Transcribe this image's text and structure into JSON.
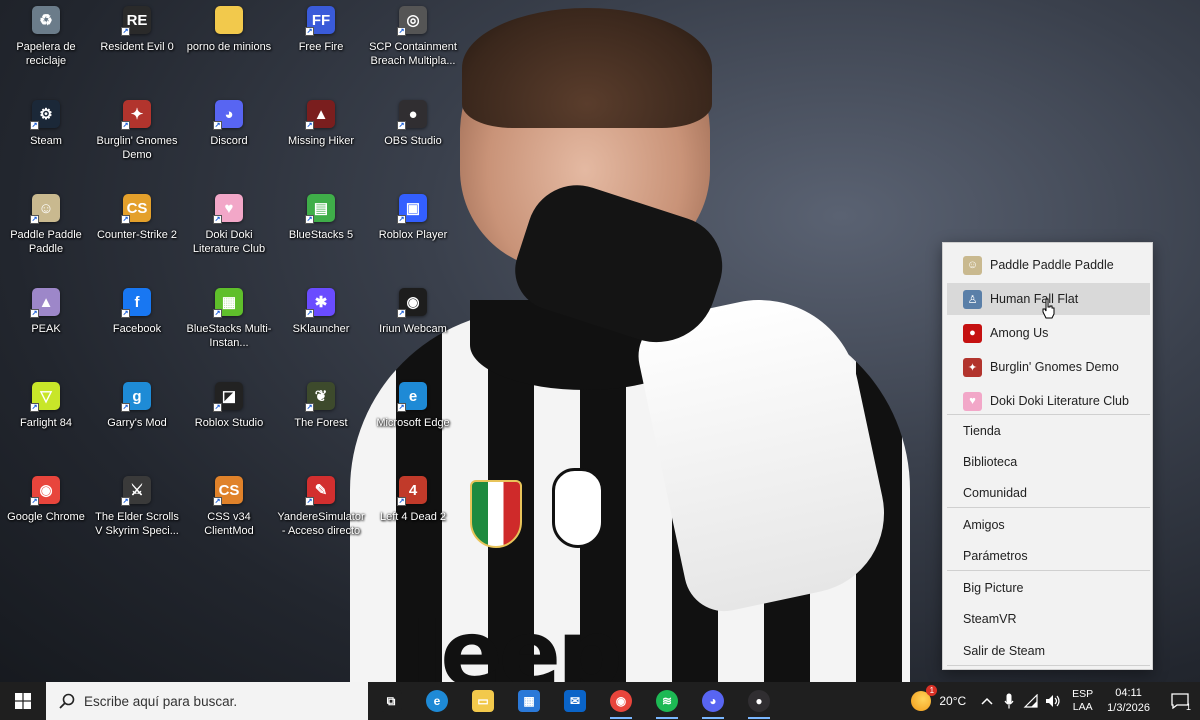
{
  "desktop_icons": [
    {
      "label": "Papelera de reciclaje",
      "icon": "recycle-bin-icon",
      "color": "#6b7c8a"
    },
    {
      "label": "Resident Evil 0",
      "icon": "resident-evil-icon",
      "color": "#2a2a2a"
    },
    {
      "label": "porno de minions",
      "icon": "folder-icon",
      "color": "#f2c94c"
    },
    {
      "label": "Free Fire",
      "icon": "free-fire-icon",
      "color": "#3a5bd9"
    },
    {
      "label": "SCP Containment Breach Multipla...",
      "icon": "scp-icon",
      "color": "#555555"
    },
    {
      "label": "Steam",
      "icon": "steam-icon",
      "color": "#1b2838"
    },
    {
      "label": "Burglin' Gnomes Demo",
      "icon": "burglin-gnomes-icon",
      "color": "#b2342d"
    },
    {
      "label": "Discord",
      "icon": "discord-icon",
      "color": "#5865f2"
    },
    {
      "label": "Missing Hiker",
      "icon": "missing-hiker-icon",
      "color": "#7a1e1e"
    },
    {
      "label": "OBS Studio",
      "icon": "obs-icon",
      "color": "#302e31"
    },
    {
      "label": "Paddle Paddle Paddle",
      "icon": "paddle-icon",
      "color": "#c9b98f"
    },
    {
      "label": "Counter-Strike 2",
      "icon": "cs2-icon",
      "color": "#e4a02b"
    },
    {
      "label": "Doki Doki Literature Club",
      "icon": "ddlc-icon",
      "color": "#f2a7c8"
    },
    {
      "label": "BlueStacks 5",
      "icon": "bluestacks-icon",
      "color": "#3fae49"
    },
    {
      "label": "Roblox Player",
      "icon": "roblox-icon",
      "color": "#335fff"
    },
    {
      "label": "PEAK",
      "icon": "peak-icon",
      "color": "#9d87c9"
    },
    {
      "label": "Facebook",
      "icon": "facebook-icon",
      "color": "#1877f2"
    },
    {
      "label": "BlueStacks Multi-Instan...",
      "icon": "bluestacks-multi-icon",
      "color": "#5fbf2b"
    },
    {
      "label": "SKlauncher",
      "icon": "sklauncher-icon",
      "color": "#6a4cff"
    },
    {
      "label": "Iriun Webcam",
      "icon": "iriun-icon",
      "color": "#1d1d1d"
    },
    {
      "label": "Farlight 84",
      "icon": "farlight-icon",
      "color": "#c8e629"
    },
    {
      "label": "Garry's Mod",
      "icon": "gmod-icon",
      "color": "#1e8bd6"
    },
    {
      "label": "Roblox Studio",
      "icon": "roblox-studio-icon",
      "color": "#222222"
    },
    {
      "label": "The Forest",
      "icon": "the-forest-icon",
      "color": "#3d4a2c"
    },
    {
      "label": "Microsoft Edge",
      "icon": "edge-icon",
      "color": "#1e8ad6"
    },
    {
      "label": "Google Chrome",
      "icon": "chrome-icon",
      "color": "#e8453c"
    },
    {
      "label": "The Elder Scrolls V Skyrim Speci...",
      "icon": "skyrim-icon",
      "color": "#3a3a3a"
    },
    {
      "label": "CSS v34 ClientMod",
      "icon": "css-icon",
      "color": "#e0822a"
    },
    {
      "label": "YandereSimulator - Acceso directo",
      "icon": "yandere-icon",
      "color": "#d22f2f"
    },
    {
      "label": "Left 4 Dead 2",
      "icon": "l4d2-icon",
      "color": "#c13a2a"
    }
  ],
  "steam_menu": {
    "games": [
      {
        "label": "Paddle Paddle Paddle",
        "icon": "paddle-icon",
        "color": "#c9b98f"
      },
      {
        "label": "Human Fall Flat",
        "icon": "human-fall-flat-icon",
        "color": "#5a7fa8"
      },
      {
        "label": "Among Us",
        "icon": "among-us-icon",
        "color": "#c51111"
      },
      {
        "label": "Burglin' Gnomes Demo",
        "icon": "burglin-gnomes-icon",
        "color": "#b2342d"
      },
      {
        "label": "Doki Doki Literature Club",
        "icon": "ddlc-icon",
        "color": "#f2a7c8"
      }
    ],
    "hovered_index": 1,
    "items": [
      {
        "label": "Tienda"
      },
      {
        "label": "Biblioteca"
      },
      {
        "label": "Comunidad"
      },
      {
        "label": "Amigos"
      },
      {
        "label": "Parámetros"
      },
      {
        "label": "Big Picture"
      },
      {
        "label": "SteamVR"
      },
      {
        "label": "Salir de Steam"
      }
    ]
  },
  "taskbar": {
    "search_placeholder": "Escribe aquí para buscar.",
    "pinned": [
      {
        "icon": "task-view-icon",
        "color": "#1f1f1f"
      },
      {
        "icon": "edge-icon",
        "color": "#1e8ad6"
      },
      {
        "icon": "file-explorer-icon",
        "color": "#f2c94c"
      },
      {
        "icon": "microsoft-store-icon",
        "color": "#2b79d8"
      },
      {
        "icon": "outlook-icon",
        "color": "#0a64c8"
      },
      {
        "icon": "chrome-icon",
        "color": "#e8453c"
      },
      {
        "icon": "spotify-icon",
        "color": "#1db954"
      },
      {
        "icon": "discord-icon",
        "color": "#5865f2"
      },
      {
        "icon": "obs-icon",
        "color": "#302e31"
      }
    ],
    "temperature": "20°C",
    "language_top": "ESP",
    "language_bottom": "LAA",
    "time": "04:11",
    "date": "1/3/2026",
    "notification_count": "1"
  }
}
